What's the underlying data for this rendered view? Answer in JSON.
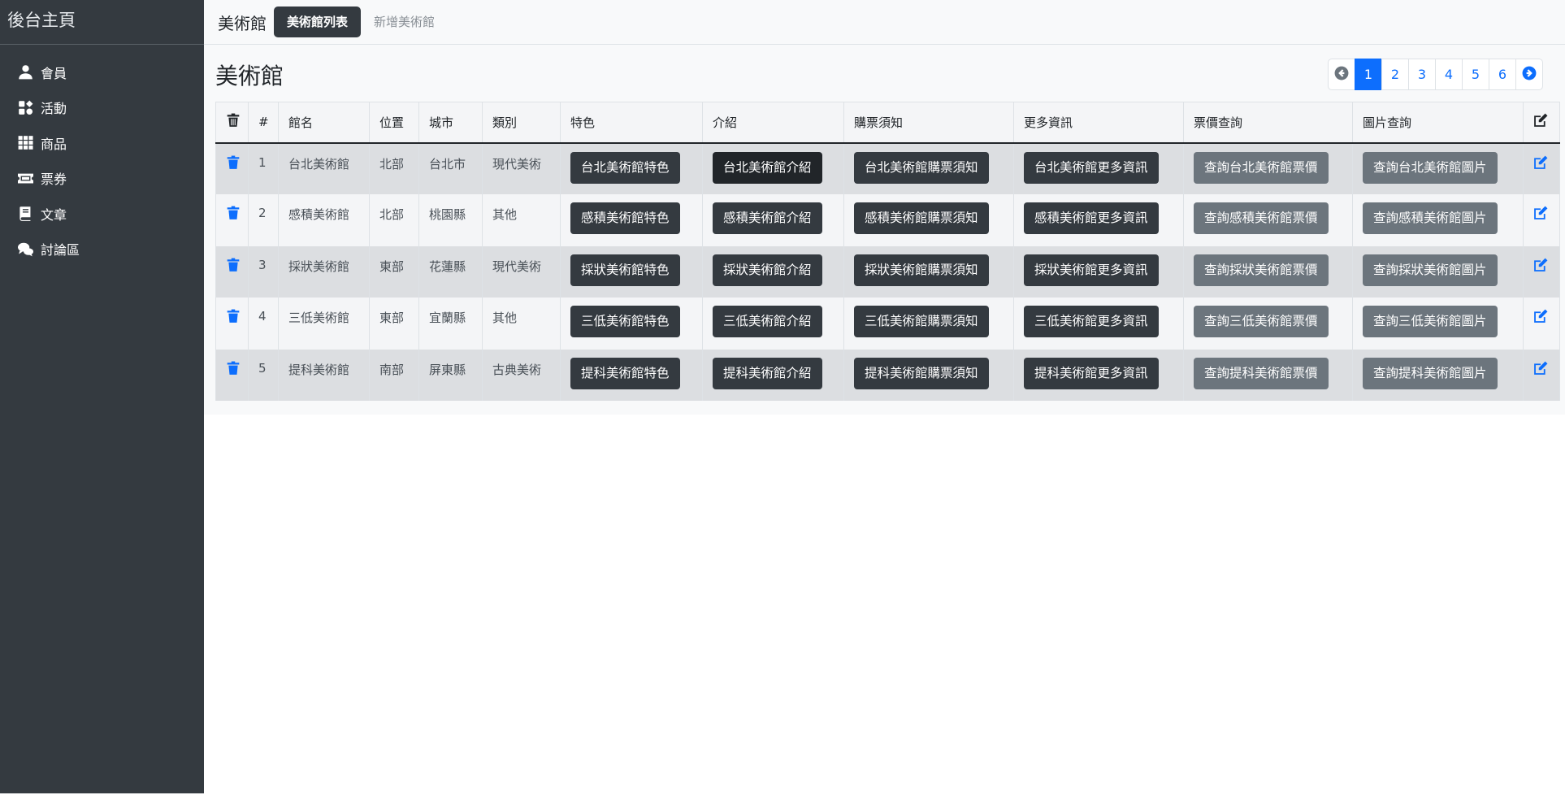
{
  "sidebar": {
    "brand": "後台主頁",
    "items": [
      {
        "label": "會員",
        "icon": "user-icon"
      },
      {
        "label": "活動",
        "icon": "activity-icon"
      },
      {
        "label": "商品",
        "icon": "grid-icon"
      },
      {
        "label": "票券",
        "icon": "ticket-icon"
      },
      {
        "label": "文章",
        "icon": "book-icon"
      },
      {
        "label": "討論區",
        "icon": "comments-icon"
      }
    ]
  },
  "topnav": {
    "brand": "美術館",
    "active_tab": "美術館列表",
    "tab": "新增美術館"
  },
  "page": {
    "title": "美術館"
  },
  "pagination": {
    "pages": [
      "1",
      "2",
      "3",
      "4",
      "5",
      "6"
    ],
    "active": "1"
  },
  "table": {
    "headers": {
      "num": "#",
      "name": "館名",
      "region": "位置",
      "city": "城市",
      "category": "類別",
      "feature": "特色",
      "intro": "介紹",
      "ticket_notice": "購票須知",
      "more_info": "更多資訊",
      "price_query": "票價查詢",
      "image_query": "圖片查詢"
    },
    "rows": [
      {
        "num": "1",
        "name": "台北美術館",
        "region": "北部",
        "city": "台北市",
        "category": "現代美術",
        "feature": "台北美術館特色",
        "intro": "台北美術館介紹",
        "ticket_notice": "台北美術館購票須知",
        "more_info": "台北美術館更多資訊",
        "price_query": "查詢台北美術館票價",
        "image_query": "查詢台北美術館圖片"
      },
      {
        "num": "2",
        "name": "感積美術館",
        "region": "北部",
        "city": "桃園縣",
        "category": "其他",
        "feature": "感積美術館特色",
        "intro": "感積美術館介紹",
        "ticket_notice": "感積美術館購票須知",
        "more_info": "感積美術館更多資訊",
        "price_query": "查詢感積美術館票價",
        "image_query": "查詢感積美術館圖片"
      },
      {
        "num": "3",
        "name": "採狀美術館",
        "region": "東部",
        "city": "花蓮縣",
        "category": "現代美術",
        "feature": "採狀美術館特色",
        "intro": "採狀美術館介紹",
        "ticket_notice": "採狀美術館購票須知",
        "more_info": "採狀美術館更多資訊",
        "price_query": "查詢採狀美術館票價",
        "image_query": "查詢採狀美術館圖片"
      },
      {
        "num": "4",
        "name": "三低美術館",
        "region": "東部",
        "city": "宜蘭縣",
        "category": "其他",
        "feature": "三低美術館特色",
        "intro": "三低美術館介紹",
        "ticket_notice": "三低美術館購票須知",
        "more_info": "三低美術館更多資訊",
        "price_query": "查詢三低美術館票價",
        "image_query": "查詢三低美術館圖片"
      },
      {
        "num": "5",
        "name": "提科美術館",
        "region": "南部",
        "city": "屏東縣",
        "category": "古典美術",
        "feature": "提科美術館特色",
        "intro": "提科美術館介紹",
        "ticket_notice": "提科美術館購票須知",
        "more_info": "提科美術館更多資訊",
        "price_query": "查詢提科美術館票價",
        "image_query": "查詢提科美術館圖片"
      }
    ]
  },
  "colors": {
    "sidebar_bg": "#343a40",
    "primary": "#0d6efd",
    "dark_button": "#343a40",
    "secondary_button": "#6c757d"
  }
}
